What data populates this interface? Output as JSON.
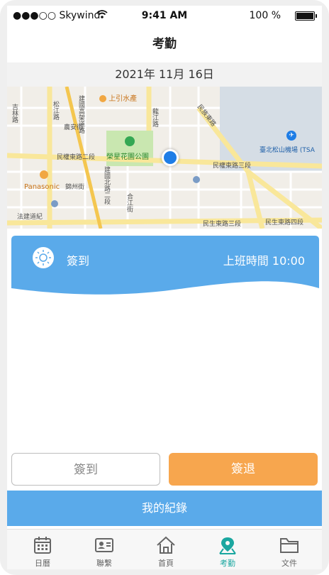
{
  "status_bar": {
    "carrier": "●●●○○ Skywind",
    "time": "9:41 AM",
    "battery": "100 %"
  },
  "header": {
    "title": "考勤"
  },
  "date": "2021年 11月 16日",
  "map": {
    "labels": {
      "jilin": "吉林路",
      "songjiang": "松江路",
      "jianguo_n_elevated": "建國高架道路",
      "shangyin": "上引水產",
      "longjiang": "龍江路",
      "minzu_e": "民族東路",
      "nongan": "農安街",
      "park": "榮星花園公園",
      "minquan_e2": "民權東路二段",
      "minquan_e3": "民權東路三段",
      "airport": "臺北松山機場 (TSA",
      "panasonic": "Panasonic",
      "jinzhou": "錦州街",
      "jianguo_n2": "建國北路二段",
      "hejiang": "合江街",
      "fajian": "法建道紀",
      "minsheng_e3": "民生東路三段",
      "minsheng_e4": "民生東路四段"
    },
    "colors": {
      "major_road": "#f9e79a",
      "minor_road": "#ffffff",
      "park": "#c9e7b0",
      "water": "#d5dde5",
      "pin": "#1e7de6"
    }
  },
  "checkin_card": {
    "label": "簽到",
    "time_label": "上班時間 10:00",
    "color": "#5aaaea"
  },
  "buttons": {
    "check_in": "簽到",
    "check_out": "簽退"
  },
  "records_button": "我的紀錄",
  "tabs": [
    {
      "label": "日曆",
      "icon": "calendar-icon",
      "active": false
    },
    {
      "label": "聯繫",
      "icon": "contact-card-icon",
      "active": false
    },
    {
      "label": "首頁",
      "icon": "home-icon",
      "active": false
    },
    {
      "label": "考勤",
      "icon": "attendance-location-icon",
      "active": true
    },
    {
      "label": "文件",
      "icon": "folder-icon",
      "active": false
    }
  ],
  "colors": {
    "accent": "#1aa7a0",
    "checkout": "#f7a64e",
    "primary_blue": "#5aaaea"
  }
}
